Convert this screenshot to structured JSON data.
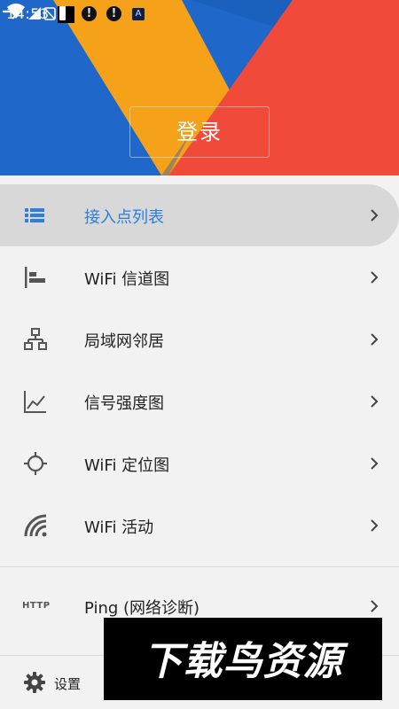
{
  "status_bar": {
    "time": "14:53",
    "notification_icons": [
      "black-square-icon",
      "alert-icon",
      "alert-icon",
      "app-a-icon"
    ],
    "right_icons": [
      "wifi-icon",
      "signal-icon",
      "no-sim-icon",
      "battery-icon"
    ]
  },
  "header": {
    "login_label": "登录",
    "exit_icon": "arrow-right-icon",
    "colors": {
      "blue": "#1e66c8",
      "orange": "#f5a11a",
      "red": "#f04a3a"
    }
  },
  "menu": {
    "items": [
      {
        "label": "接入点列表",
        "icon": "list-icon",
        "selected": true
      },
      {
        "label": "WiFi 信道图",
        "icon": "channel-chart-icon",
        "selected": false
      },
      {
        "label": "局域网邻居",
        "icon": "lan-network-icon",
        "selected": false
      },
      {
        "label": "信号强度图",
        "icon": "line-chart-icon",
        "selected": false
      },
      {
        "label": "WiFi 定位图",
        "icon": "crosshair-icon",
        "selected": false
      },
      {
        "label": "WiFi 活动",
        "icon": "wifi-activity-icon",
        "selected": false
      }
    ],
    "ping": {
      "label": "Ping (网络诊断)",
      "icon_text": "HTTP"
    },
    "accent_color": "#2d7ee0"
  },
  "footer": {
    "settings_label": "设置",
    "settings_icon": "gear-icon"
  },
  "watermark": {
    "text": "下载鸟资源"
  }
}
